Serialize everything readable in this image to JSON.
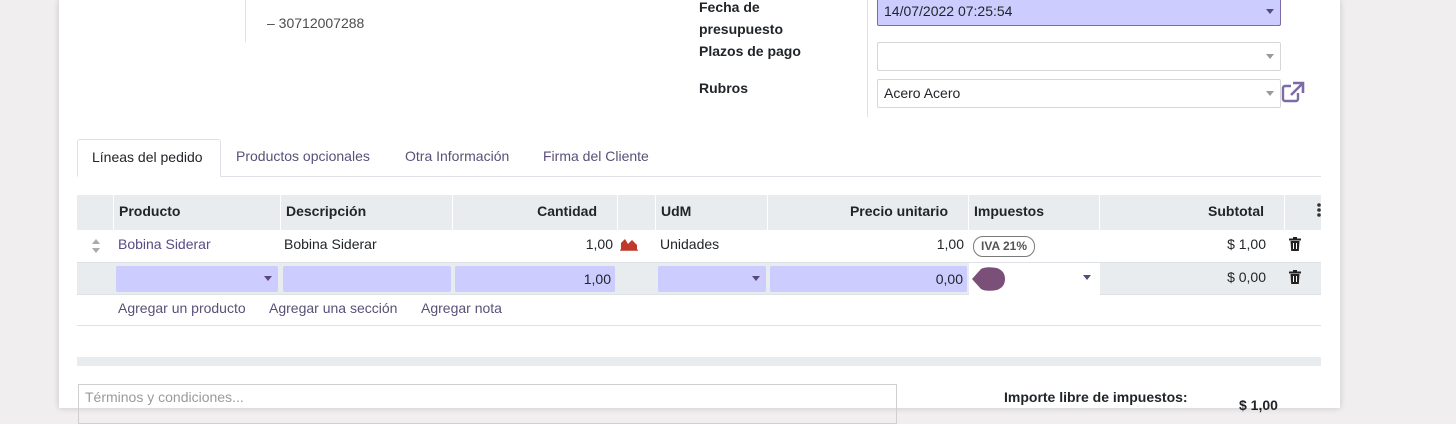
{
  "customer": {
    "vat_line": "– 30712007288"
  },
  "fields": {
    "quote_date": {
      "label": "Fecha de presupuesto",
      "value": "14/07/2022 07:25:54"
    },
    "payment_terms": {
      "label": "Plazos de pago",
      "value": ""
    },
    "rubros": {
      "label": "Rubros",
      "value": "Acero Acero"
    }
  },
  "tabs": [
    {
      "label": "Líneas del pedido",
      "active": true
    },
    {
      "label": "Productos opcionales",
      "active": false
    },
    {
      "label": "Otra Información",
      "active": false
    },
    {
      "label": "Firma del Cliente",
      "active": false
    }
  ],
  "table": {
    "columns": {
      "product": "Producto",
      "description": "Descripción",
      "quantity": "Cantidad",
      "uom": "UdM",
      "unit_price": "Precio unitario",
      "taxes": "Impuestos",
      "subtotal": "Subtotal"
    },
    "rows": [
      {
        "product": "Bobina Siderar",
        "description": "Bobina Siderar",
        "quantity": "1,00",
        "uom": "Unidades",
        "unit_price": "1,00",
        "tax_badge": "IVA 21%",
        "subtotal": "$ 1,00"
      }
    ],
    "edit_row": {
      "product": "",
      "description": "",
      "quantity": "1,00",
      "uom": "",
      "unit_price": "0,00",
      "subtotal": "$ 0,00"
    },
    "add_links": {
      "product": "Agregar un producto",
      "section": "Agregar una sección",
      "note": "Agregar nota"
    }
  },
  "terms": {
    "placeholder": "Términos y condiciones..."
  },
  "totals": {
    "untaxed_label": "Importe libre de impuestos:",
    "untaxed_value": "$ 1,00"
  },
  "icons": {
    "external_link": "external-link-icon",
    "forecast": "area-chart-icon",
    "delete": "trash-icon",
    "handle": "drag-handle-icon",
    "options": "vertical-dots-icon"
  },
  "colors": {
    "accent": "#7d6ba7",
    "active_field": "#ccccff",
    "chart_red": "#c0392b"
  }
}
